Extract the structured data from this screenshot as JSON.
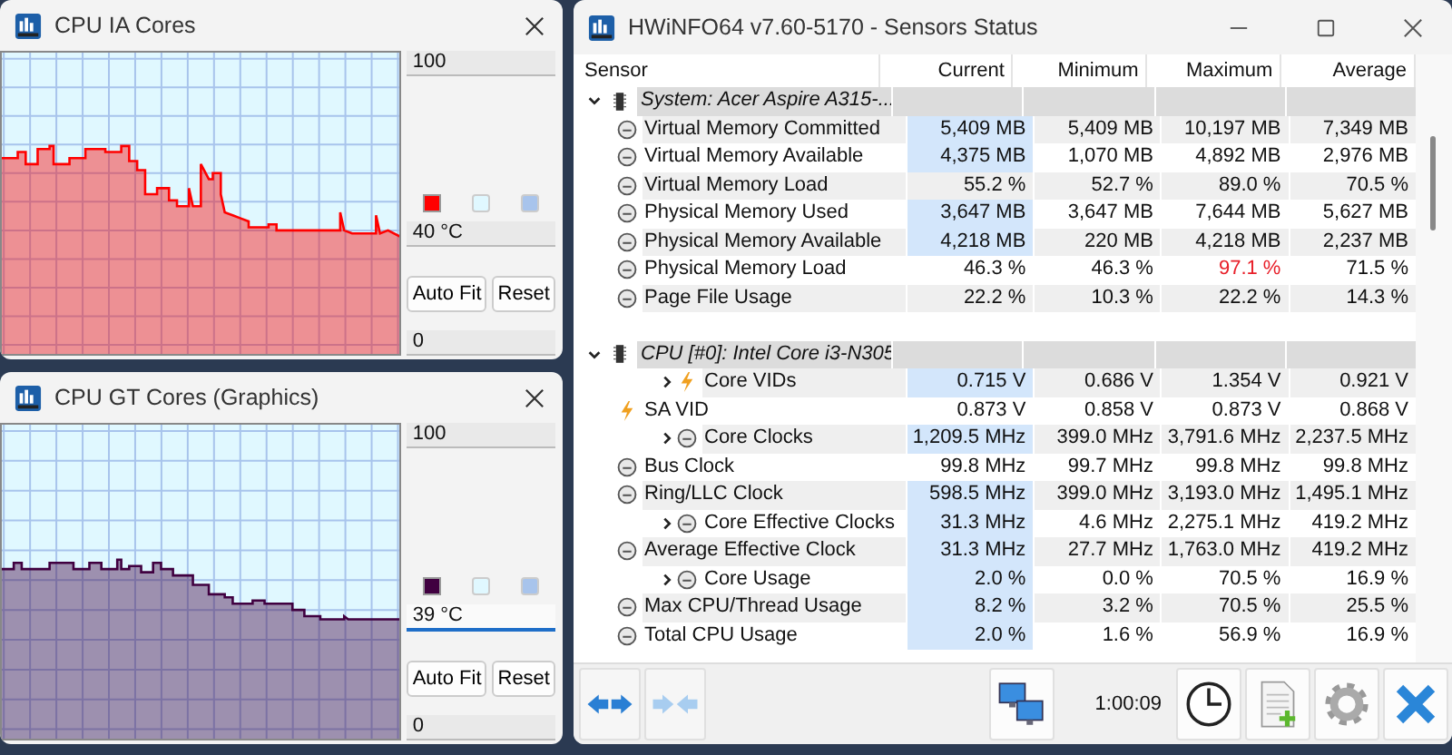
{
  "graph_windows": [
    {
      "title": "CPU IA Cores",
      "max_field": "100",
      "value_field": "40 °C",
      "value_focused": false,
      "min_field": "0",
      "swatches": [
        {
          "color": "#ff0000"
        },
        {
          "color": "#e0f8ff"
        },
        {
          "color": "#a8c4ec"
        }
      ],
      "buttons": [
        "Auto Fit",
        "Reset"
      ]
    },
    {
      "title": "CPU GT Cores (Graphics)",
      "max_field": "100",
      "value_field": "39 °C",
      "value_focused": true,
      "min_field": "0",
      "swatches": [
        {
          "color": "#400040"
        },
        {
          "color": "#e0f8ff"
        },
        {
          "color": "#a8c4ec"
        }
      ],
      "buttons": [
        "Auto Fit",
        "Reset"
      ]
    }
  ],
  "sensors_window": {
    "title": "HWiNFO64 v7.60-5170 - Sensors Status",
    "columns": [
      "Sensor",
      "Current",
      "Minimum",
      "Maximum",
      "Average"
    ],
    "groups": [
      {
        "name": "System: Acer Aspire A315-...",
        "expanded": true,
        "children": [
          {
            "kind": "gauge",
            "has_children": false,
            "label": "Virtual Memory Committed",
            "current": "5,409 MB",
            "minimum": "5,409 MB",
            "maximum": "10,197 MB",
            "average": "7,349 MB",
            "highlighted": true,
            "max_alert": false
          },
          {
            "kind": "gauge",
            "has_children": false,
            "label": "Virtual Memory Available",
            "current": "4,375 MB",
            "minimum": "1,070 MB",
            "maximum": "4,892 MB",
            "average": "2,976 MB",
            "highlighted": true,
            "max_alert": false
          },
          {
            "kind": "gauge",
            "has_children": false,
            "label": "Virtual Memory Load",
            "current": "55.2 %",
            "minimum": "52.7 %",
            "maximum": "89.0 %",
            "average": "70.5 %",
            "highlighted": false,
            "max_alert": false
          },
          {
            "kind": "gauge",
            "has_children": false,
            "label": "Physical Memory Used",
            "current": "3,647 MB",
            "minimum": "3,647 MB",
            "maximum": "7,644 MB",
            "average": "5,627 MB",
            "highlighted": true,
            "max_alert": false
          },
          {
            "kind": "gauge",
            "has_children": false,
            "label": "Physical Memory Available",
            "current": "4,218 MB",
            "minimum": "220 MB",
            "maximum": "4,218 MB",
            "average": "2,237 MB",
            "highlighted": true,
            "max_alert": false
          },
          {
            "kind": "gauge",
            "has_children": false,
            "label": "Physical Memory Load",
            "current": "46.3 %",
            "minimum": "46.3 %",
            "maximum": "97.1 %",
            "average": "71.5 %",
            "highlighted": false,
            "max_alert": true
          },
          {
            "kind": "gauge",
            "has_children": false,
            "label": "Page File Usage",
            "current": "22.2 %",
            "minimum": "10.3 %",
            "maximum": "22.2 %",
            "average": "14.3 %",
            "highlighted": false,
            "max_alert": false
          }
        ]
      },
      {
        "name": "CPU [#0]: Intel Core i3-N305",
        "expanded": true,
        "children": [
          {
            "kind": "bolt",
            "has_children": true,
            "label": "Core VIDs",
            "current": "0.715 V",
            "minimum": "0.686 V",
            "maximum": "1.354 V",
            "average": "0.921 V",
            "highlighted": true,
            "max_alert": false
          },
          {
            "kind": "bolt",
            "has_children": false,
            "label": "SA VID",
            "current": "0.873 V",
            "minimum": "0.858 V",
            "maximum": "0.873 V",
            "average": "0.868 V",
            "highlighted": false,
            "max_alert": false
          },
          {
            "kind": "gauge",
            "has_children": true,
            "label": "Core Clocks",
            "current": "1,209.5 MHz",
            "minimum": "399.0 MHz",
            "maximum": "3,791.6 MHz",
            "average": "2,237.5 MHz",
            "highlighted": true,
            "max_alert": false
          },
          {
            "kind": "gauge",
            "has_children": false,
            "label": "Bus Clock",
            "current": "99.8 MHz",
            "minimum": "99.7 MHz",
            "maximum": "99.8 MHz",
            "average": "99.8 MHz",
            "highlighted": false,
            "max_alert": false
          },
          {
            "kind": "gauge",
            "has_children": false,
            "label": "Ring/LLC Clock",
            "current": "598.5 MHz",
            "minimum": "399.0 MHz",
            "maximum": "3,193.0 MHz",
            "average": "1,495.1 MHz",
            "highlighted": true,
            "max_alert": false
          },
          {
            "kind": "gauge",
            "has_children": true,
            "label": "Core Effective Clocks",
            "current": "31.3 MHz",
            "minimum": "4.6 MHz",
            "maximum": "2,275.1 MHz",
            "average": "419.2 MHz",
            "highlighted": true,
            "max_alert": false
          },
          {
            "kind": "gauge",
            "has_children": false,
            "label": "Average Effective Clock",
            "current": "31.3 MHz",
            "minimum": "27.7 MHz",
            "maximum": "1,763.0 MHz",
            "average": "419.2 MHz",
            "highlighted": true,
            "max_alert": false
          },
          {
            "kind": "gauge",
            "has_children": true,
            "label": "Core Usage",
            "current": "2.0 %",
            "minimum": "0.0 %",
            "maximum": "70.5 %",
            "average": "16.9 %",
            "highlighted": true,
            "max_alert": false
          },
          {
            "kind": "gauge",
            "has_children": false,
            "label": "Max CPU/Thread Usage",
            "current": "8.2 %",
            "minimum": "3.2 %",
            "maximum": "70.5 %",
            "average": "25.5 %",
            "highlighted": true,
            "max_alert": false
          },
          {
            "kind": "gauge",
            "has_children": false,
            "label": "Total CPU Usage",
            "current": "2.0 %",
            "minimum": "1.6 %",
            "maximum": "56.9 %",
            "average": "16.9 %",
            "highlighted": true,
            "max_alert": false
          }
        ]
      }
    ],
    "elapsed_time": "1:00:09"
  }
}
